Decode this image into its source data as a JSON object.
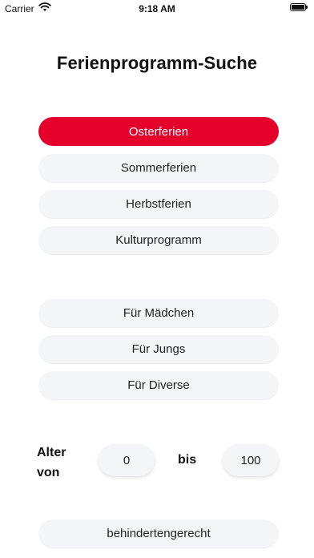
{
  "status_bar": {
    "carrier": "Carrier",
    "time": "9:18 AM"
  },
  "title": "Ferienprogramm-Suche",
  "seasons": [
    {
      "label": "Osterferien",
      "active": true
    },
    {
      "label": "Sommerferien",
      "active": false
    },
    {
      "label": "Herbstferien",
      "active": false
    },
    {
      "label": "Kulturprogramm",
      "active": false
    }
  ],
  "audiences": [
    {
      "label": "Für Mädchen"
    },
    {
      "label": "Für Jungs"
    },
    {
      "label": "Für Diverse"
    }
  ],
  "age": {
    "label_line1": "Alter",
    "label_line2": "von",
    "from_value": "0",
    "to_label": "bis",
    "to_value": "100"
  },
  "accessible_label": "behindertengerecht",
  "colors": {
    "accent": "#e4002b",
    "pill_bg": "#f4f5f7"
  }
}
